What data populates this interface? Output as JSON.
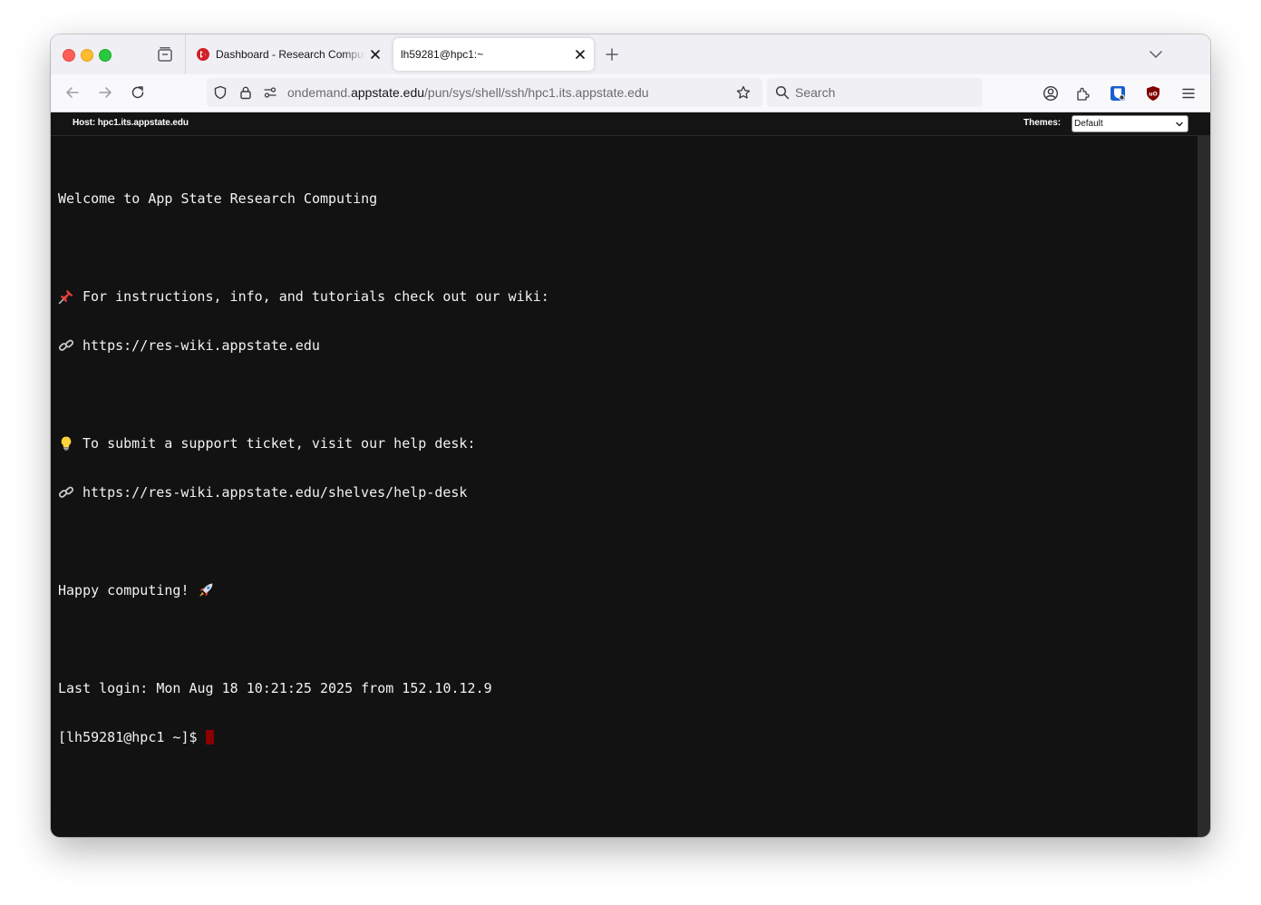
{
  "browser": {
    "tabs": [
      {
        "title": "Dashboard - Research Computing",
        "active": false,
        "favicon": "ondemand-logo-icon"
      },
      {
        "title": "lh59281@hpc1:~",
        "active": true
      }
    ],
    "url": {
      "prefix": "ondemand.",
      "domain": "appstate.edu",
      "path": "/pun/sys/shell/ssh/hpc1.its.appstate.edu"
    },
    "search_placeholder": "Search"
  },
  "shell_header": {
    "host_label": "Host: hpc1.its.appstate.edu",
    "themes_label": "Themes:",
    "theme_selected": "Default"
  },
  "terminal": {
    "welcome": "Welcome to App State Research Computing",
    "wiki_text": "For instructions, info, and tutorials check out our wiki:",
    "wiki_url": "https://res-wiki.appstate.edu",
    "help_text": "To submit a support ticket, visit our help desk:",
    "help_url": "https://res-wiki.appstate.edu/shelves/help-desk",
    "happy": "Happy computing!",
    "last_login": "Last login: Mon Aug 18 10:21:25 2025 from 152.10.12.9",
    "prompt": "[lh59281@hpc1 ~]$"
  },
  "colors": {
    "terminal_bg": "#121212",
    "terminal_fg": "#f2f2f2",
    "cursor": "#8b0000",
    "header_bg": "#141414"
  }
}
